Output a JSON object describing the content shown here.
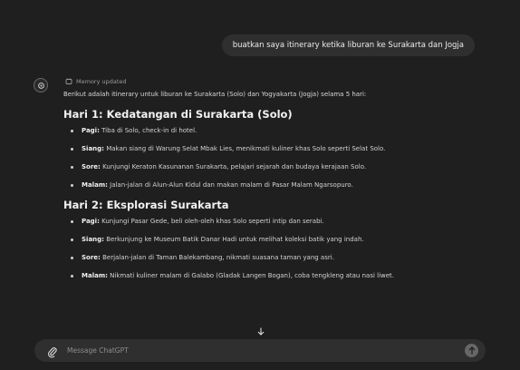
{
  "conversation": {
    "user_message": "buatkan saya itinerary ketika liburan ke Surakarta dan Jogja",
    "memory_status": "Memory updated",
    "intro": "Berikut adalah itinerary untuk liburan ke Surakarta (Solo) dan Yogyakarta (Jogja) selama 5 hari:",
    "days": [
      {
        "title": "Hari 1: Kedatangan di Surakarta (Solo)",
        "items": [
          {
            "label": "Pagi:",
            "text": " Tiba di Solo, check-in di hotel."
          },
          {
            "label": "Siang:",
            "text": " Makan siang di Warung Selat Mbak Lies, menikmati kuliner khas Solo seperti Selat Solo."
          },
          {
            "label": "Sore:",
            "text": " Kunjungi Keraton Kasunanan Surakarta, pelajari sejarah dan budaya kerajaan Solo."
          },
          {
            "label": "Malam:",
            "text": " Jalan-jalan di Alun-Alun Kidul dan makan malam di Pasar Malam Ngarsopuro."
          }
        ]
      },
      {
        "title": "Hari 2: Eksplorasi Surakarta",
        "items": [
          {
            "label": "Pagi:",
            "text": " Kunjungi Pasar Gede, beli oleh-oleh khas Solo seperti intip dan serabi."
          },
          {
            "label": "Siang:",
            "text": " Berkunjung ke Museum Batik Danar Hadi untuk melihat koleksi batik yang indah."
          },
          {
            "label": "Sore:",
            "text": " Berjalan-jalan di Taman Balekambang, nikmati suasana taman yang asri."
          },
          {
            "label": "Malam:",
            "text": " Nikmati kuliner malam di Galabo (Gladak Langen Bogan), coba tengkleng atau nasi liwet."
          }
        ]
      }
    ]
  },
  "composer": {
    "placeholder": "Message ChatGPT"
  },
  "icons": {
    "assistant": "openai-logo-icon",
    "memory": "memory-icon",
    "scroll": "arrow-down-icon",
    "attach": "paperclip-icon",
    "send": "arrow-up-icon"
  },
  "colors": {
    "background": "#1f1f1f",
    "bubble": "#2f2f2f",
    "send_button": "#676767"
  }
}
